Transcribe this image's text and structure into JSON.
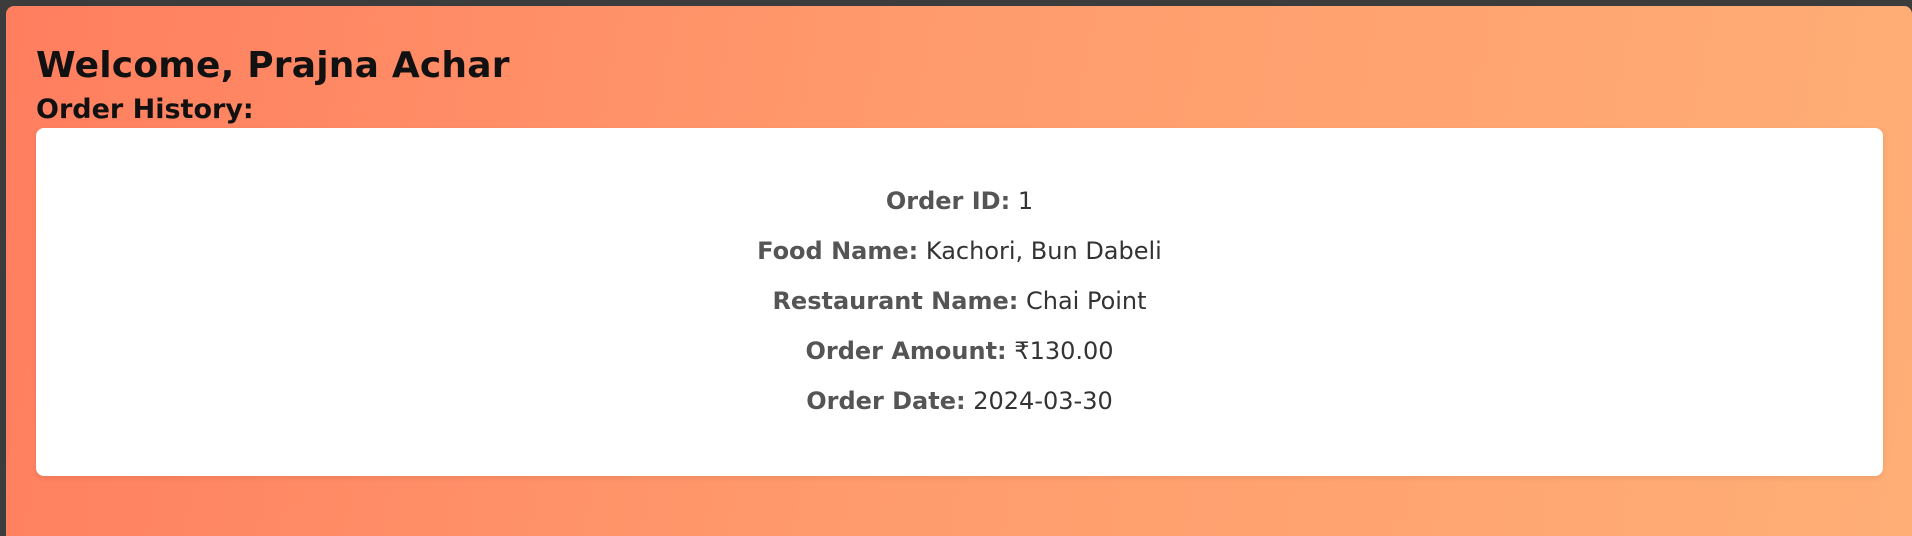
{
  "page": {
    "welcome": "Welcome, Prajna Achar",
    "history_title": "Order History:"
  },
  "order": {
    "id_label": "Order ID:",
    "id": "1",
    "food_label": "Food Name:",
    "food": "Kachori, Bun Dabeli",
    "restaurant_label": "Restaurant Name:",
    "restaurant": "Chai Point",
    "amount_label": "Order Amount:",
    "amount": "₹130.00",
    "date_label": "Order Date:",
    "date": "2024-03-30"
  },
  "colors": {
    "gradient_start": "#ff7e5f",
    "gradient_end": "#ffae76",
    "card": "#ffffff"
  }
}
